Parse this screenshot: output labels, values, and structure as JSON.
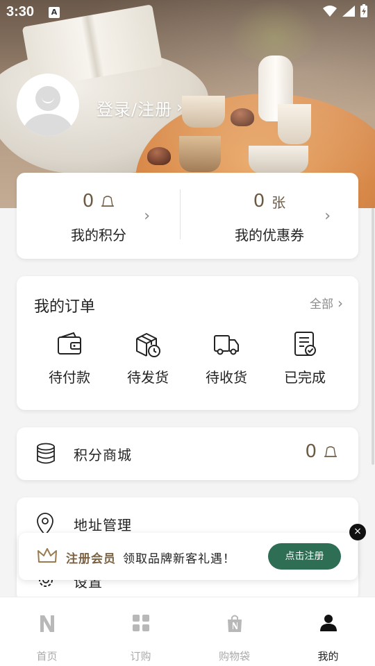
{
  "status": {
    "time": "3:30",
    "a_icon": "A"
  },
  "profile": {
    "login_label": "登录/注册",
    "chevron": "›"
  },
  "stats": {
    "points": {
      "value": "0",
      "label": "我的积分"
    },
    "coupons": {
      "value": "0",
      "unit": "张",
      "label": "我的优惠券"
    }
  },
  "orders": {
    "title": "我的订单",
    "all_label": "全部",
    "items": [
      {
        "label": "待付款",
        "icon": "wallet-icon"
      },
      {
        "label": "待发货",
        "icon": "package-clock-icon"
      },
      {
        "label": "待收货",
        "icon": "truck-icon"
      },
      {
        "label": "已完成",
        "icon": "document-check-icon"
      }
    ]
  },
  "mall": {
    "label": "积分商城",
    "value": "0",
    "icon": "coins-stack-icon"
  },
  "address": {
    "label": "地址管理",
    "icon": "location-pin-icon"
  },
  "settings": {
    "label": "设置",
    "icon": "gear-icon"
  },
  "banner": {
    "highlight": "注册会员",
    "text": "领取品牌新客礼遇！",
    "button": "点击注册",
    "close": "×"
  },
  "tabs": [
    {
      "label": "首页",
      "icon": "brand-n-icon",
      "active": false
    },
    {
      "label": "订购",
      "icon": "grid-icon",
      "active": false
    },
    {
      "label": "购物袋",
      "icon": "shopping-bag-icon",
      "active": false
    },
    {
      "label": "我的",
      "icon": "user-icon",
      "active": true
    }
  ],
  "colors": {
    "accent_brown": "#6d5a43",
    "button_green": "#2e6e55"
  }
}
